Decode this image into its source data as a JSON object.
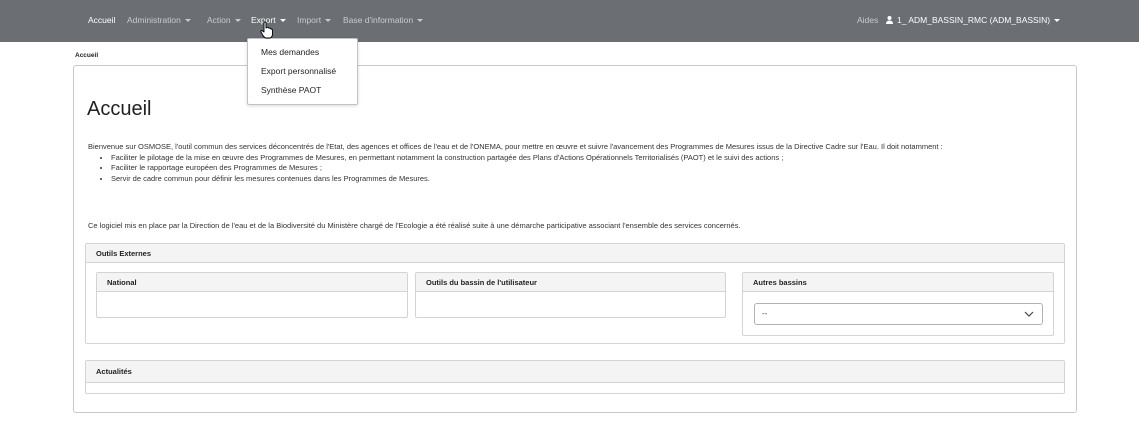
{
  "navbar": {
    "items": [
      {
        "label": "Accueil"
      },
      {
        "label": "Administration"
      },
      {
        "label": "Action"
      },
      {
        "label": "Export"
      },
      {
        "label": "Import"
      },
      {
        "label": "Base d'information"
      }
    ],
    "right": {
      "help": "Aides",
      "user": "1_ ADM_BASSIN_RMC (ADM_BASSIN)"
    }
  },
  "export_menu": {
    "items": [
      "Mes demandes",
      "Export personnalisé",
      "Synthèse PAOT"
    ]
  },
  "breadcrumb": "Accueil",
  "page": {
    "title": "Accueil",
    "intro": "Bienvenue sur OSMOSE, l'outil commun des services déconcentrés de l'Etat, des agences et offices de l'eau et de l'ONEMA, pour mettre en œuvre et suivre l'avancement des Programmes de Mesures issus de la Directive Cadre sur l'Eau. Il doit notamment :",
    "bullets": [
      "Faciliter le pilotage de la mise en œuvre des Programmes de Mesures, en permettant notamment la construction partagée des Plans d'Actions Opérationnels Territorialisés (PAOT) et le suivi des actions ;",
      "Faciliter le rapportage européen des Programmes de Mesures ;",
      "Servir de cadre commun pour définir les mesures contenues dans les Programmes de Mesures."
    ],
    "closing": "Ce logiciel mis en place par la Direction de l'eau et de la Biodiversité du Ministère chargé de l'Ecologie a été réalisé suite à une démarche participative associant l'ensemble des services concernés."
  },
  "outils_externes": {
    "title": "Outils Externes",
    "national": "National",
    "bassin_utilisateur": "Outils du bassin de l'utilisateur",
    "autres_bassins": "Autres bassins",
    "select_value": "--"
  },
  "actualites": {
    "title": "Actualités"
  },
  "colors": {
    "navbar_bg": "#6b6e73",
    "nav_text": "#c9cbce",
    "panel_head_bg": "#f4f4f4"
  }
}
